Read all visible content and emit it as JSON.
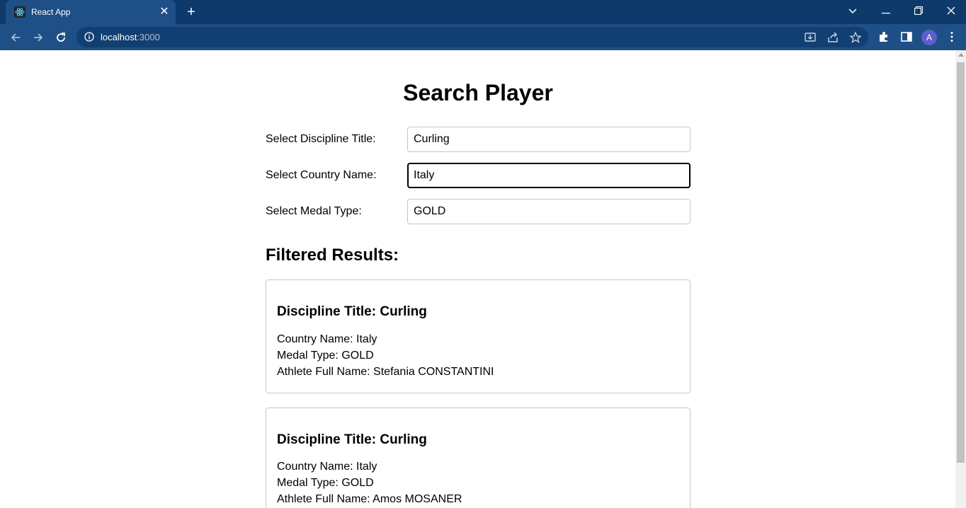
{
  "browser": {
    "tab_title": "React App",
    "url_host": "localhost",
    "url_port": ":3000",
    "avatar_letter": "A"
  },
  "page": {
    "title": "Search Player",
    "filters": [
      {
        "label": "Select Discipline Title:",
        "value": "Curling"
      },
      {
        "label": "Select Country Name:",
        "value": "Italy"
      },
      {
        "label": "Select Medal Type:",
        "value": "GOLD"
      }
    ],
    "results_title": "Filtered Results:",
    "results": [
      {
        "title": "Discipline Title: Curling",
        "country": "Country Name: Italy",
        "medal": "Medal Type: GOLD",
        "athlete": "Athlete Full Name: Stefania CONSTANTINI"
      },
      {
        "title": "Discipline Title: Curling",
        "country": "Country Name: Italy",
        "medal": "Medal Type: GOLD",
        "athlete": "Athlete Full Name: Amos MOSANER"
      }
    ]
  }
}
